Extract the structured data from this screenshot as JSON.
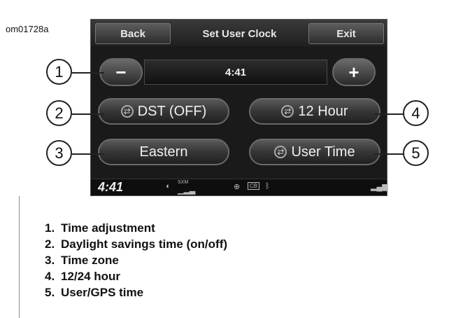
{
  "figure_id": "om01728a",
  "screen": {
    "header": {
      "back_label": "Back",
      "title": "Set User Clock",
      "exit_label": "Exit"
    },
    "time_value": "4:41",
    "minus_label": "−",
    "plus_label": "+",
    "buttons": {
      "dst_label": "DST (OFF)",
      "hour_label": "12 Hour",
      "zone_label": "Eastern",
      "time_source_label": "User Time"
    },
    "status_bar": {
      "clock": "4:41",
      "icons": [
        "signal-icon",
        "sxm-icon",
        "harley-logo-icon",
        "cb-icon",
        "bluetooth-icon",
        "cell-signal-icon"
      ],
      "cb_label": "CB",
      "sxm_label": "SXM"
    }
  },
  "callouts": [
    "1",
    "2",
    "3",
    "4",
    "5"
  ],
  "legend": [
    {
      "num": "1.",
      "text": "Time adjustment"
    },
    {
      "num": "2.",
      "text": "Daylight savings time (on/off)"
    },
    {
      "num": "3.",
      "text": "Time zone"
    },
    {
      "num": "4.",
      "text": "12/24 hour"
    },
    {
      "num": "5.",
      "text": "User/GPS time"
    }
  ]
}
